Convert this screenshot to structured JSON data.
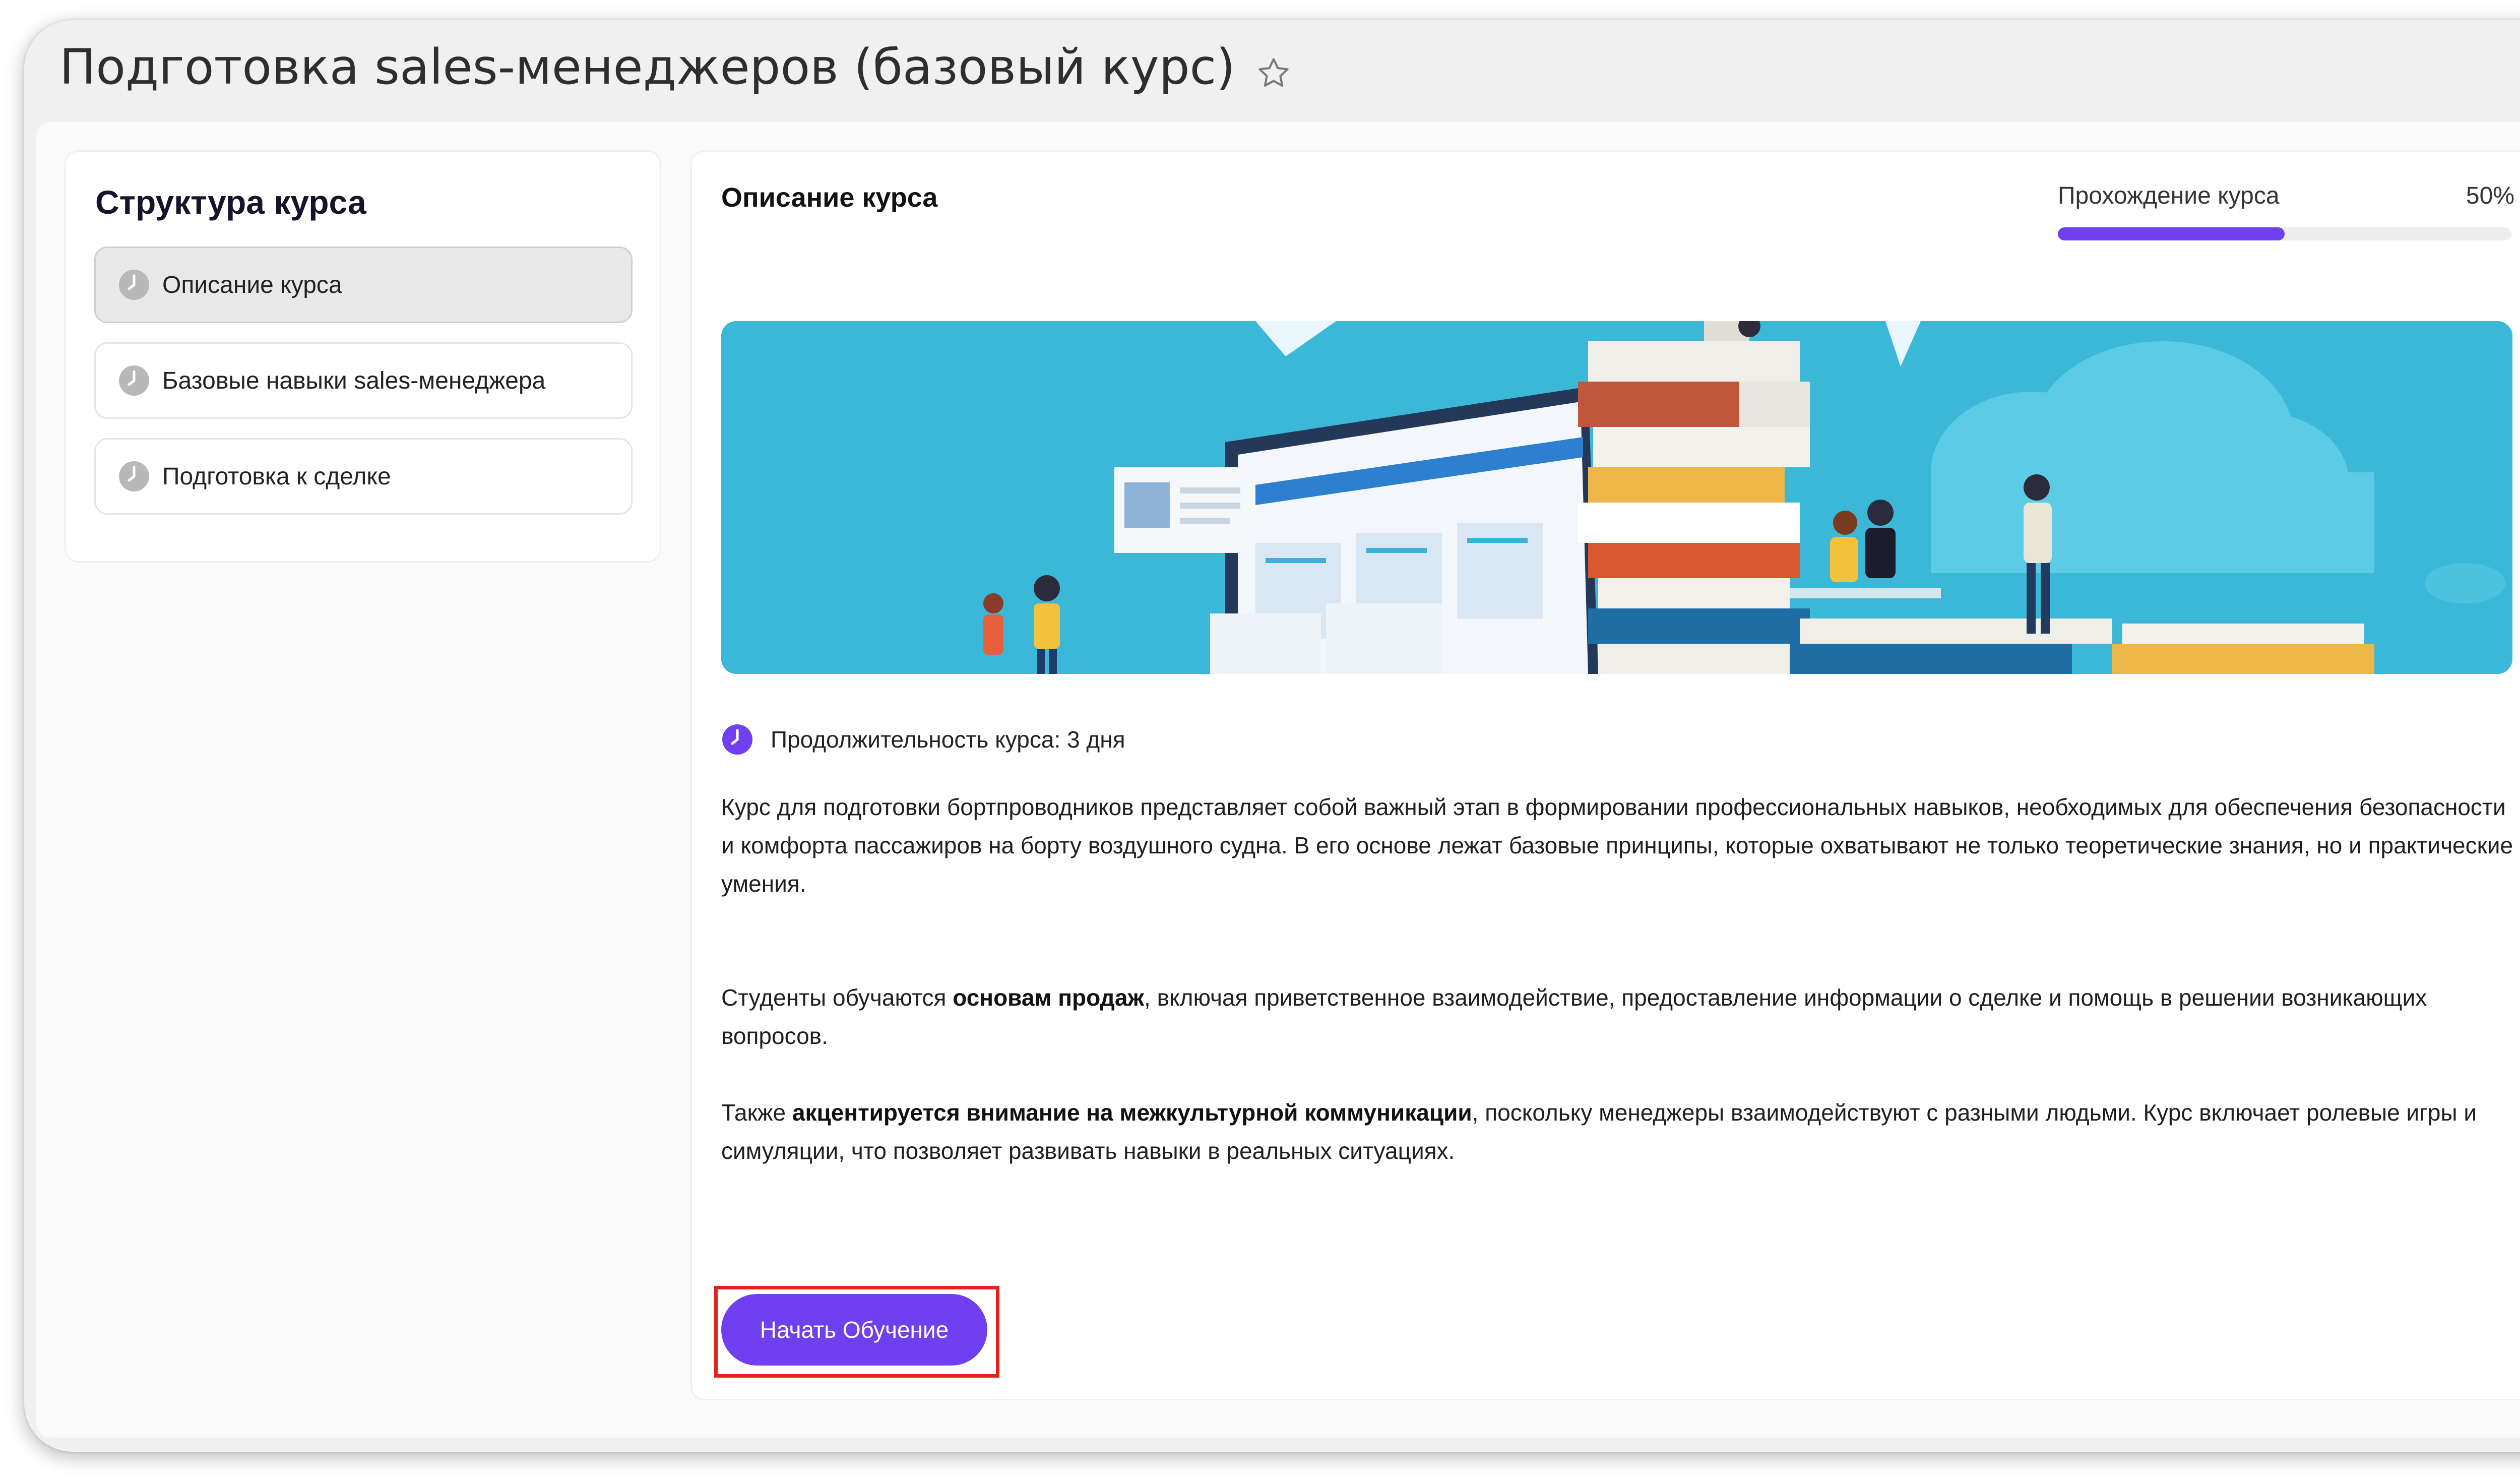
{
  "page": {
    "title": "Подготовка sales-менеджеров (базовый курс)",
    "favorite_icon": "star-outline-icon"
  },
  "sidebar": {
    "title": "Структура курса",
    "items": [
      {
        "label": "Описание курса",
        "icon": "clock-icon",
        "active": true
      },
      {
        "label": "Базовые навыки sales-менеджера",
        "icon": "clock-icon",
        "active": false
      },
      {
        "label": "Подготовка к сделке",
        "icon": "clock-icon",
        "active": false
      }
    ]
  },
  "main": {
    "title": "Описание курса",
    "progress": {
      "label": "Прохождение курса",
      "value_text": "50%",
      "value": 50
    },
    "duration": {
      "icon": "clock-icon",
      "text": "Продолжительность курса: 3 дня"
    },
    "paragraphs": [
      {
        "parts": [
          {
            "text": "Курс для подготовки бортпроводников представляет собой важный этап в формировании профессиональных навыков, необходимых для обеспечения безопасности и комфорта пассажиров на борту воздушного судна. В его основе лежат базовые принципы, которые охватывают не только теоретические знания, но и практические умения."
          }
        ]
      },
      {
        "parts": [
          {
            "text": "Студенты обучаются "
          },
          {
            "text": "основам продаж",
            "bold": true
          },
          {
            "text": ", включая приветственное взаимодействие, предоставление информации о сделке и помощь в решении возникающих вопросов."
          }
        ]
      },
      {
        "parts": [
          {
            "text": "Также "
          },
          {
            "text": "акцентируется внимание на межкультурной коммуникации",
            "bold": true
          },
          {
            "text": ", поскольку менеджеры взаимодействуют с разными людьми. Курс включает ролевые игры и симуляции, что позволяет развивать навыки в реальных ситуациях."
          }
        ]
      }
    ],
    "start_button": "Начать Обучение"
  },
  "colors": {
    "accent": "#6f3ff0",
    "highlight_box": "#e3231b",
    "banner_bg": "#3bb8d8",
    "muted_icon": "#b8b8b8"
  }
}
